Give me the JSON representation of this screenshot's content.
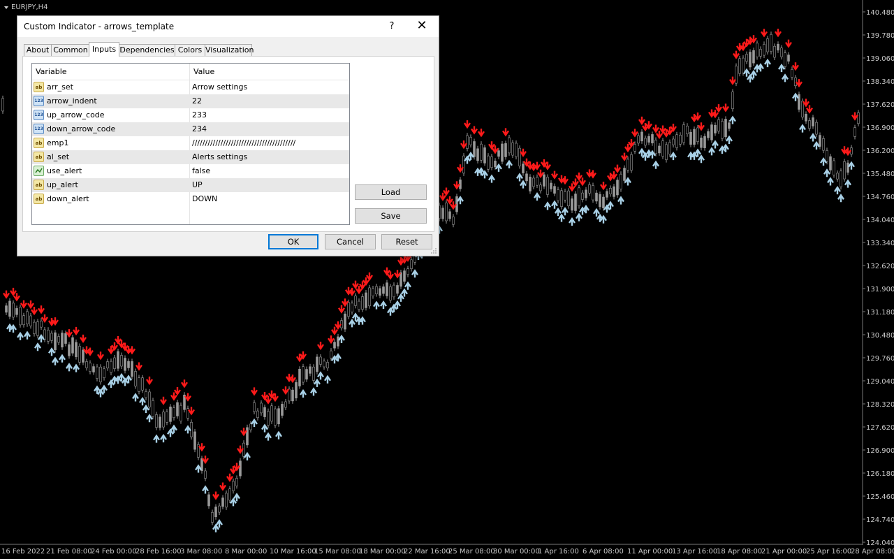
{
  "chart": {
    "symbol_label": "EURJPY,H4",
    "bg_color": "#000000",
    "candle_color": "#9a9a9a",
    "up_arrow_color": "#a8d0e6",
    "down_arrow_color": "#ff1a1a",
    "price_labels": [
      "140.480",
      "139.780",
      "139.060",
      "138.340",
      "137.620",
      "136.900",
      "136.200",
      "135.480",
      "134.760",
      "134.040",
      "133.340",
      "132.620",
      "131.900",
      "131.180",
      "130.480",
      "129.760",
      "129.040",
      "128.320",
      "127.620",
      "126.900",
      "126.180",
      "125.460",
      "124.740",
      "124.040"
    ],
    "date_labels": [
      "16 Feb 2022",
      "21 Feb 08:00",
      "24 Feb 00:00",
      "28 Feb 16:00",
      "3 Mar 08:00",
      "8 Mar 00:00",
      "10 Mar 16:00",
      "15 Mar 08:00",
      "18 Mar 00:00",
      "22 Mar 16:00",
      "25 Mar 08:00",
      "30 Mar 00:00",
      "1 Apr 16:00",
      "6 Apr 08:00",
      "11 Apr 00:00",
      "13 Apr 16:00",
      "18 Apr 08:00",
      "21 Apr 00:00",
      "25 Apr 16:00",
      "28 Apr 08:00"
    ]
  },
  "dialog": {
    "title": "Custom Indicator - arrows_template",
    "help_glyph": "?",
    "close_glyph": "✕",
    "tabs": [
      {
        "label": "About"
      },
      {
        "label": "Common"
      },
      {
        "label": "Inputs"
      },
      {
        "label": "Dependencies"
      },
      {
        "label": "Colors"
      },
      {
        "label": "Visualization"
      }
    ],
    "active_tab": "Inputs",
    "grid": {
      "col_variable": "Variable",
      "col_value": "Value",
      "rows": [
        {
          "icon": "ab",
          "type": "string",
          "name": "arr_set",
          "value": "Arrow settings"
        },
        {
          "icon": "123",
          "type": "int",
          "name": "arrow_indent",
          "value": "22"
        },
        {
          "icon": "123",
          "type": "int",
          "name": "up_arrow_code",
          "value": "233"
        },
        {
          "icon": "123",
          "type": "int",
          "name": "down_arrow_code",
          "value": "234"
        },
        {
          "icon": "ab",
          "type": "string",
          "name": "emp1",
          "value": "////////////////////////////////////////"
        },
        {
          "icon": "ab",
          "type": "string",
          "name": "al_set",
          "value": "Alerts settings"
        },
        {
          "icon": "bool",
          "type": "bool",
          "name": "use_alert",
          "value": "false"
        },
        {
          "icon": "ab",
          "type": "string",
          "name": "up_alert",
          "value": "UP"
        },
        {
          "icon": "ab",
          "type": "string",
          "name": "down_alert",
          "value": "DOWN"
        }
      ]
    },
    "buttons": {
      "load": "Load",
      "save": "Save",
      "ok": "OK",
      "cancel": "Cancel",
      "reset": "Reset"
    }
  }
}
